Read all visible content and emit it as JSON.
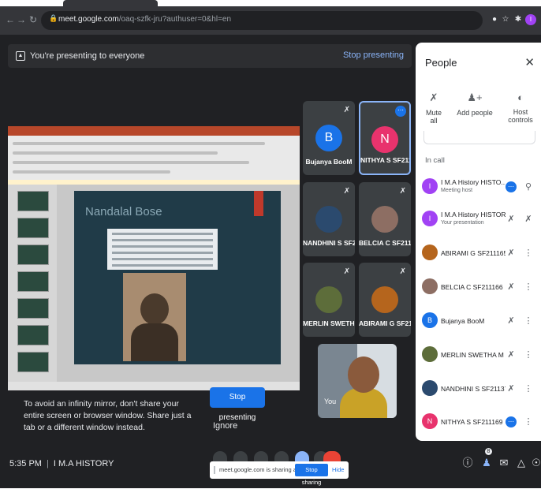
{
  "browser": {
    "url_host": "meet.google.com",
    "url_path": "/oaq-szfk-jru?authuser=0&hl=en",
    "back_icon": "arrow-left-icon",
    "forward_icon": "arrow-right-icon",
    "reload_icon": "reload-icon",
    "profile_initial": "I"
  },
  "banner": {
    "text": "You're presenting to everyone",
    "stop_label": "Stop presenting"
  },
  "presentation": {
    "slide_title": "Nandalal Bose"
  },
  "mirror_warning": {
    "text": "To avoid an infinity mirror, don't share your entire screen or browser window. Share just a tab or a different window instead.",
    "stop_label": "Stop presenting",
    "ignore_label": "Ignore"
  },
  "tiles": [
    {
      "name": "Bujanya BooM",
      "initial": "B",
      "color": "#1a73e8"
    },
    {
      "name": "NITHYA S SF211...",
      "initial": "N",
      "color": "#e8336d"
    },
    {
      "name": "NANDHINI S SF2...",
      "initial": "",
      "color": "#2b4a6e"
    },
    {
      "name": "BELCIA C SF211...",
      "initial": "",
      "color": "#8d6e63"
    },
    {
      "name": "MERLIN SWETH...",
      "initial": "",
      "color": "#5d6d3a"
    },
    {
      "name": "ABIRAMI G SF211...",
      "initial": "",
      "color": "#b5651d"
    }
  ],
  "self_tile": {
    "label": "You"
  },
  "bottom": {
    "time": "5:35 PM",
    "meeting_name": "I M.A HISTORY",
    "people_count": "8"
  },
  "share_bar": {
    "text": "meet.google.com is sharing a window.",
    "stop_label": "Stop sharing",
    "hide_label": "Hide"
  },
  "people_panel": {
    "title": "People",
    "close_icon": "close-icon",
    "actions": [
      {
        "label": "Mute all",
        "icon": "mic-off-icon"
      },
      {
        "label": "Add people",
        "icon": "add-person-icon"
      },
      {
        "label": "Host controls",
        "icon": "toggle-icon"
      }
    ],
    "section_label": "In call",
    "participants": [
      {
        "name": "I M.A History HISTO... (You)",
        "sub": "Meeting host",
        "initial": "I",
        "color": "#a142f4"
      },
      {
        "name": "I M.A History HISTORY",
        "sub": "Your presentation",
        "initial": "I",
        "color": "#a142f4"
      },
      {
        "name": "ABIRAMI G SF211165",
        "sub": "",
        "initial": "",
        "color": "#b5651d"
      },
      {
        "name": "BELCIA C SF211166",
        "sub": "",
        "initial": "",
        "color": "#8d6e63"
      },
      {
        "name": "Bujanya BooM",
        "sub": "",
        "initial": "B",
        "color": "#1a73e8"
      },
      {
        "name": "MERLIN SWETHA M SF211...",
        "sub": "",
        "initial": "",
        "color": "#5d6d3a"
      },
      {
        "name": "NANDHINI S SF211378",
        "sub": "",
        "initial": "",
        "color": "#2b4a6e"
      },
      {
        "name": "NITHYA S SF211169",
        "sub": "",
        "initial": "N",
        "color": "#e8336d"
      }
    ]
  }
}
